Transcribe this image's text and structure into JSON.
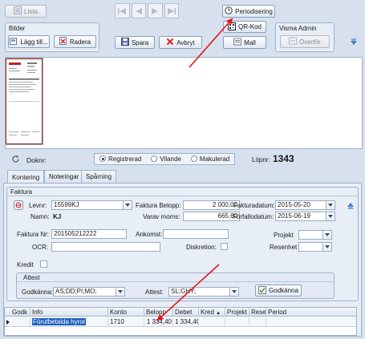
{
  "toolbar": {
    "lista_label": "Lista",
    "periodisering_label": "Periodisering",
    "qrkod_label": "QR-Kod",
    "spara_label": "Spara",
    "avbryt_label": "Avbryt",
    "mall_label": "Mall"
  },
  "bilder": {
    "title": "Bilder",
    "lagg_till_label": "Lägg till...",
    "radera_label": "Radera"
  },
  "visma": {
    "title": "Visma Admin",
    "overfor_label": "Överför"
  },
  "status": {
    "doknr_label": "Doknr:",
    "options": [
      "Registrerad",
      "Vilande",
      "Makulerad"
    ],
    "selected": "Registrerad",
    "lopnr_label": "Löpnr:",
    "lopnr_value": "1343"
  },
  "tabs": [
    "Kontering",
    "Noteringar",
    "Spårning"
  ],
  "faktura": {
    "title": "Faktura",
    "levnr_label": "Levnr:",
    "levnr_value": "15599KJ",
    "namn_label": "Namn:",
    "namn_value": "KJ",
    "belopp_label": "Faktura Belopp:",
    "belopp_value": "2 000,00",
    "moms_label": "Varav moms:",
    "moms_value": "665,60",
    "fakturadatum_label": "Fakturadatum:",
    "fakturadatum_value": "2015-05-20",
    "forfallodatum_label": "Förfallodatum:",
    "forfallodatum_value": "2015-06-19",
    "fakturanr_label": "Faktura Nr:",
    "fakturanr_value": "201505212222",
    "ankomst_label": "Ankomst:",
    "ankomst_value": "",
    "projekt_label": "Projekt",
    "ocr_label": "OCR:",
    "ocr_value": "",
    "diskretion_label": "Diskretion:",
    "resenhet_label": "Resenhet",
    "kredit_label": "Kredit"
  },
  "attest": {
    "title": "Attest",
    "godkanna_label": "Godkänna:",
    "godkanna_value": "AS;DD;PI;MO;",
    "attest_label": "Attest:",
    "attest_value": "SL;GHY;",
    "godkanna_button": "Godkänna"
  },
  "grid": {
    "columns": [
      "Godk",
      "Info",
      "Konto",
      "Belopp",
      "Debet",
      "Kred",
      "Projekt",
      "Rese",
      "Period"
    ],
    "rows": [
      {
        "godk": "",
        "info": "Förutbetalda hyror",
        "konto": "1710",
        "belopp": "1 334,40",
        "debet": "1 334,40",
        "kred": "",
        "projekt": "",
        "rese": "",
        "period": ""
      }
    ]
  },
  "colors": {
    "background": "#d7e1ee",
    "annotation_arrow": "#e8141c",
    "selection": "#1f5fbf"
  }
}
